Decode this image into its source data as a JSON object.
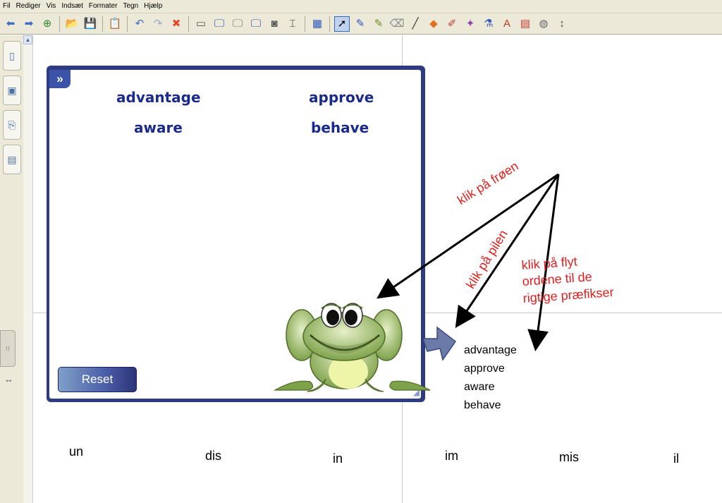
{
  "menu": [
    "Fil",
    "Rediger",
    "Vis",
    "Indsæt",
    "Formater",
    "Tegn",
    "Hjælp"
  ],
  "toolbar": {
    "buttons": [
      {
        "name": "back-arrow-icon",
        "glyph": "⬅",
        "color": "#3d6fc4"
      },
      {
        "name": "forward-arrow-icon",
        "glyph": "➡",
        "color": "#3d6fc4"
      },
      {
        "name": "add-page-icon",
        "glyph": "⊕",
        "color": "#2e8b2e"
      },
      {
        "sep": true
      },
      {
        "name": "open-folder-icon",
        "glyph": "📂",
        "color": "#d9a520"
      },
      {
        "name": "save-icon",
        "glyph": "💾",
        "color": "#2d58b8"
      },
      {
        "sep": true
      },
      {
        "name": "paste-icon",
        "glyph": "📋",
        "color": "#8a6d3b"
      },
      {
        "sep": true
      },
      {
        "name": "undo-icon",
        "glyph": "↶",
        "color": "#3d6fc4"
      },
      {
        "name": "redo-icon",
        "glyph": "↷",
        "color": "#9aaac8"
      },
      {
        "name": "delete-icon",
        "glyph": "✖",
        "color": "#e04a2c"
      },
      {
        "sep": true
      },
      {
        "name": "screen-shade-icon",
        "glyph": "▭",
        "color": "#555555"
      },
      {
        "name": "full-screen-icon",
        "glyph": "🖵",
        "color": "#2d58b8"
      },
      {
        "name": "transparent-layer-icon",
        "glyph": "🖵",
        "color": "#777777"
      },
      {
        "name": "dual-page-icon",
        "glyph": "🖵",
        "color": "#2d58b8"
      },
      {
        "name": "capture-icon",
        "glyph": "◙",
        "color": "#555555"
      },
      {
        "name": "text-box-icon",
        "glyph": "⌶",
        "color": "#333333"
      },
      {
        "sep": true
      },
      {
        "name": "table-icon",
        "glyph": "▦",
        "color": "#2d58b8"
      },
      {
        "sep": true
      },
      {
        "name": "select-pointer-icon",
        "glyph": "➚",
        "color": "#000000",
        "active": true
      },
      {
        "name": "pen-icon",
        "glyph": "✎",
        "color": "#2d58b8"
      },
      {
        "name": "creative-pen-icon",
        "glyph": "✎",
        "color": "#6b8e23"
      },
      {
        "name": "eraser-icon",
        "glyph": "⌫",
        "color": "#888888"
      },
      {
        "name": "line-icon",
        "glyph": "╱",
        "color": "#333333"
      },
      {
        "name": "shapes-icon",
        "glyph": "◆",
        "color": "#e07020"
      },
      {
        "name": "shape-recognition-pen-icon",
        "glyph": "✐",
        "color": "#c0392b"
      },
      {
        "name": "magic-pen-icon",
        "glyph": "✦",
        "color": "#8e44ad"
      },
      {
        "name": "fill-icon",
        "glyph": "⚗",
        "color": "#2d58b8"
      },
      {
        "name": "text-color-icon",
        "glyph": "A",
        "color": "#c0392b"
      },
      {
        "name": "properties-icon",
        "glyph": "▤",
        "color": "#c0392b"
      },
      {
        "name": "measure-icon",
        "glyph": "◍",
        "color": "#666666"
      },
      {
        "name": "move-toolbar-icon",
        "glyph": "↕",
        "color": "#555555"
      }
    ]
  },
  "side_tabs": [
    {
      "name": "page-sorter-icon",
      "glyph": "▯"
    },
    {
      "name": "gallery-icon",
      "glyph": "▣"
    },
    {
      "name": "attachments-icon",
      "glyph": "⎘"
    },
    {
      "name": "properties-tab-icon",
      "glyph": "▤"
    }
  ],
  "activity": {
    "words": [
      "advantage",
      "approve",
      "aware",
      "behave"
    ],
    "reset_label": "Reset"
  },
  "word_list": [
    "advantage",
    "approve",
    "aware",
    "behave"
  ],
  "annotations": {
    "click_frog": "klik på frøen",
    "click_arrow": "klik på pilen",
    "move_words_line1": "klik på flyt",
    "move_words_line2": "ordene til de",
    "move_words_line3": "rigtige præfikser"
  },
  "prefixes": [
    "un",
    "dis",
    "in",
    "im",
    "mis",
    "il"
  ],
  "colors": {
    "annotation": "#e01e1e",
    "activity_frame": "#2e3b80",
    "word": "#1a2a8c"
  }
}
